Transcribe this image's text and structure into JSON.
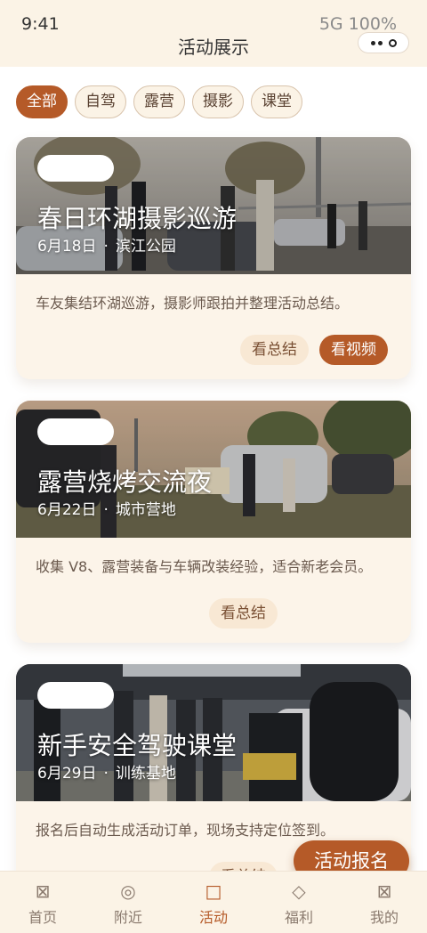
{
  "status": {
    "time": "9:41",
    "network": "5G 100%"
  },
  "header": {
    "title": "活动展示"
  },
  "filters": [
    {
      "label": "全部",
      "active": true
    },
    {
      "label": "自驾",
      "active": false
    },
    {
      "label": "露营",
      "active": false
    },
    {
      "label": "摄影",
      "active": false
    },
    {
      "label": "课堂",
      "active": false
    }
  ],
  "events": [
    {
      "title": "春日环湖摄影巡游",
      "date": "6月18日",
      "location": "滨江公园",
      "description": "车友集结环湖巡游，摄影师跟拍并整理活动总结。",
      "actions": [
        "看总结",
        "看视频"
      ]
    },
    {
      "title": "露营烧烤交流夜",
      "date": "6月22日",
      "location": "城市营地",
      "description": "收集 V8、露营装备与车辆改装经验，适合新老会员。",
      "actions": [
        "看总结"
      ]
    },
    {
      "title": "新手安全驾驶课堂",
      "date": "6月29日",
      "location": "训练基地",
      "description": "报名后自动生成活动订单，现场支持定位签到。",
      "actions": [
        "看总结"
      ]
    }
  ],
  "fab": {
    "label": "活动报名"
  },
  "tabs": [
    {
      "label": "首页",
      "icon": "box-x-icon",
      "glyph": "⊠"
    },
    {
      "label": "附近",
      "icon": "target-icon",
      "glyph": "◎"
    },
    {
      "label": "活动",
      "icon": "square-icon",
      "glyph": "□",
      "active": true
    },
    {
      "label": "福利",
      "icon": "diamond-icon",
      "glyph": "◇"
    },
    {
      "label": "我的",
      "icon": "box-x-icon",
      "glyph": "⊠"
    }
  ],
  "colors": {
    "accent": "#b55a28",
    "background": "#fbf3e6",
    "card": "#fcf4e9"
  }
}
